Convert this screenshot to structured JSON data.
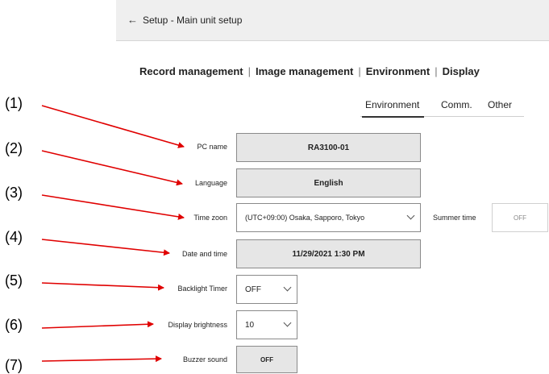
{
  "header": {
    "back_icon": "arrow-left-icon",
    "title": "Setup - Main unit setup"
  },
  "main_nav": {
    "items": [
      "Record management",
      "Image management",
      "Environment",
      "Display"
    ],
    "separator": "|"
  },
  "sub_tabs": {
    "items": [
      "Environment",
      "Comm.",
      "Other"
    ],
    "active": "Environment"
  },
  "settings": {
    "pc_name": {
      "label": "PC name",
      "value": "RA3100-01"
    },
    "language": {
      "label": "Language",
      "value": "English"
    },
    "time_zone": {
      "label": "Time zoon",
      "value": "(UTC+09:00) Osaka, Sapporo, Tokyo"
    },
    "summer_time": {
      "label": "Summer time",
      "value": "OFF"
    },
    "date_time": {
      "label": "Date and time",
      "value": "11/29/2021 1:30 PM"
    },
    "backlight_timer": {
      "label": "Backlight Timer",
      "value": "OFF"
    },
    "display_brightness": {
      "label": "Display brightness",
      "value": "10"
    },
    "buzzer_sound": {
      "label": "Buzzer sound",
      "value": "OFF"
    }
  },
  "annotations": [
    "(1)",
    "(2)",
    "(3)",
    "(4)",
    "(5)",
    "(6)",
    "(7)"
  ],
  "colors": {
    "arrow": "#e00000",
    "field_gray": "#e6e6e6",
    "topbar": "#efefef"
  }
}
